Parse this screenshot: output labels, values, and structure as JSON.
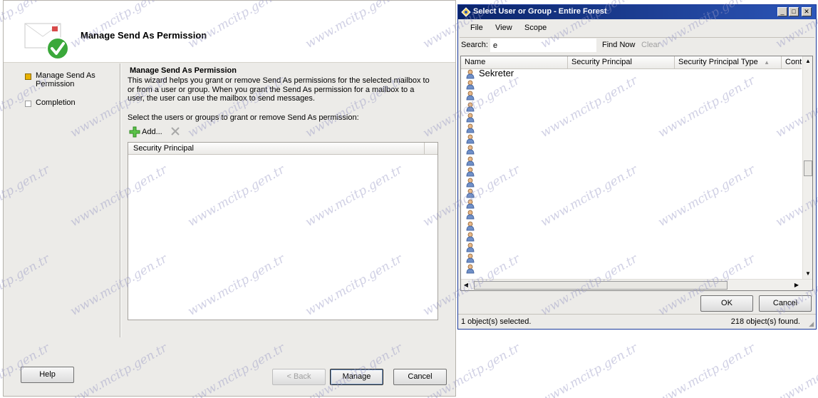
{
  "wizard": {
    "title": "Manage Send As Permission",
    "steps": [
      {
        "label": "Manage Send As Permission",
        "state": "active"
      },
      {
        "label": "Completion",
        "state": "inactive"
      }
    ],
    "content": {
      "title": "Manage Send As Permission",
      "description": "This wizard helps you grant or remove Send As permissions for the selected mailbox to or from a user or group. When you grant the Send As permission for a mailbox to a user, the user can use the mailbox to send messages.",
      "select_label": "Select the users or groups to grant or remove Send As permission:",
      "add_label": "Add...",
      "list_header": "Security Principal"
    },
    "buttons": {
      "help": "Help",
      "back": "< Back",
      "manage": "Manage",
      "cancel": "Cancel"
    }
  },
  "dialog": {
    "title": "Select User or Group - Entire Forest",
    "menu": [
      "File",
      "View",
      "Scope"
    ],
    "search_label": "Search:",
    "search_value": "e",
    "find_now": "Find Now",
    "clear": "Clear",
    "columns": [
      "Name",
      "Security Principal",
      "Security Principal Type",
      "Cont"
    ],
    "rows": [
      "Sekreter",
      "",
      "",
      "",
      "",
      "",
      "",
      "",
      "",
      "",
      "",
      "",
      "",
      "",
      "",
      "",
      "",
      "",
      ""
    ],
    "ok": "OK",
    "cancel": "Cancel",
    "status_selected": "1 object(s) selected.",
    "status_found": "218 object(s) found."
  },
  "watermark": "www.mcitp.gen.tr",
  "colors": {
    "titlebar": "#0a246a",
    "step_active": "#e8b100",
    "check_green": "#3aa83a"
  }
}
